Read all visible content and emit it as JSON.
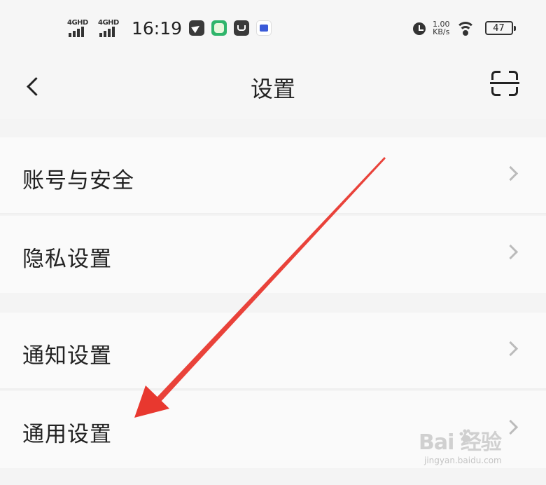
{
  "status_bar": {
    "signal_1_label": "4GHD",
    "signal_2_label": "4GHD",
    "time": "16:19",
    "app_icons": [
      "telegram-icon",
      "green-app-icon",
      "mail-icon",
      "tv-app-icon"
    ],
    "alarm_icon": "alarm-icon",
    "speed_value": "1.00",
    "speed_unit": "KB/s",
    "wifi_icon": "wifi-icon",
    "battery_level": "47"
  },
  "nav": {
    "back_icon": "chevron-left-icon",
    "title": "设置",
    "scan_icon": "scan-icon"
  },
  "sections": [
    {
      "items": [
        {
          "label": "账号与安全"
        },
        {
          "label": "隐私设置"
        }
      ]
    },
    {
      "items": [
        {
          "label": "通知设置"
        },
        {
          "label": "通用设置"
        }
      ]
    }
  ],
  "annotation": {
    "arrow_color": "#e8382f"
  },
  "watermark": {
    "brand": "Bai  经验",
    "url": "jingyan.baidu.com"
  }
}
